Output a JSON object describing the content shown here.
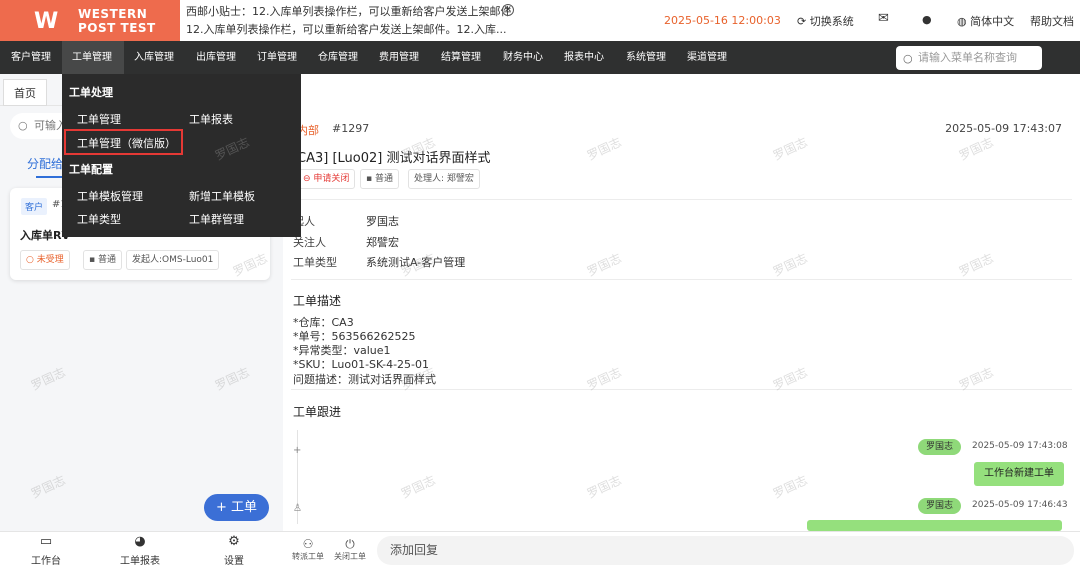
{
  "brand": {
    "line1": "WESTERN",
    "line2": "POST TEST"
  },
  "tips": {
    "line1": "西邮小贴士：12.入库单列表操作栏，可以重新给客户发送上架邮件",
    "line2": "12.入库单列表操作栏，可以重新给客户发送上架邮件。12.入库..."
  },
  "datetime": "2025-05-16 12:00:03",
  "topbar": {
    "switch_system": "切换系统",
    "language": "简体中文",
    "help": "帮助文档"
  },
  "menu": {
    "items": [
      "客户管理",
      "工单管理",
      "入库管理",
      "出库管理",
      "订单管理",
      "仓库管理",
      "费用管理",
      "结算管理",
      "财务中心",
      "报表中心",
      "系统管理",
      "渠道管理"
    ],
    "search_placeholder": "请输入菜单名称查询"
  },
  "dropdown": {
    "section1": "工单处理",
    "item_manage": "工单管理",
    "item_report": "工单报表",
    "item_wechat": "工单管理（微信版）",
    "section2": "工单配置",
    "item_template": "工单模板管理",
    "item_new_template": "新增工单模板",
    "item_type": "工单类型",
    "item_group": "工单群管理"
  },
  "left": {
    "tab_home": "首页",
    "search_placeholder": "可输入",
    "tab_assigned": "分配给",
    "card": {
      "tag": "客户",
      "num": "#1",
      "title": "入库单RV",
      "status": "未受理",
      "priority": "普通",
      "initiator": "发起人:OMS-Luo01"
    },
    "add_button": "+ 工单",
    "nav": [
      "工作台",
      "工单报表",
      "设置"
    ]
  },
  "detail": {
    "source": "内部",
    "number": "#1297",
    "date": "2025-05-09 17:43:07",
    "title": "CA3] [Luo02] 测试对话界面样式",
    "status": "申请关闭",
    "priority": "普通",
    "handler": "处理人: 郑譬宏",
    "fields": [
      {
        "label": "起人",
        "value": "罗国志"
      },
      {
        "label": "关注人",
        "value": "郑譬宏"
      },
      {
        "label": "工单类型",
        "value": "系统测试A-客户管理"
      }
    ],
    "desc_title": "工单描述",
    "desc_lines": [
      "*仓库：CA3",
      "*单号：563566262525",
      "*异常类型：value1",
      "*SKU：Luo01-SK-4-25-01",
      "问题描述：测试对话界面样式"
    ],
    "follow_title": "工单跟进",
    "messages": [
      {
        "user": "罗国志",
        "time": "2025-05-09 17:43:08",
        "text": "工作台新建工单"
      },
      {
        "user": "罗国志",
        "time": "2025-05-09 17:46:43"
      }
    ],
    "actions": [
      "转派工单",
      "关闭工单"
    ],
    "reply_placeholder": "添加回复"
  },
  "watermark": "罗国志",
  "colors": {
    "brand": "#ee6b4d",
    "menu_bg": "#2f3030",
    "accent_blue": "#2f6fd8",
    "chat_green": "#95e07d",
    "highlight_red": "#e53935"
  }
}
